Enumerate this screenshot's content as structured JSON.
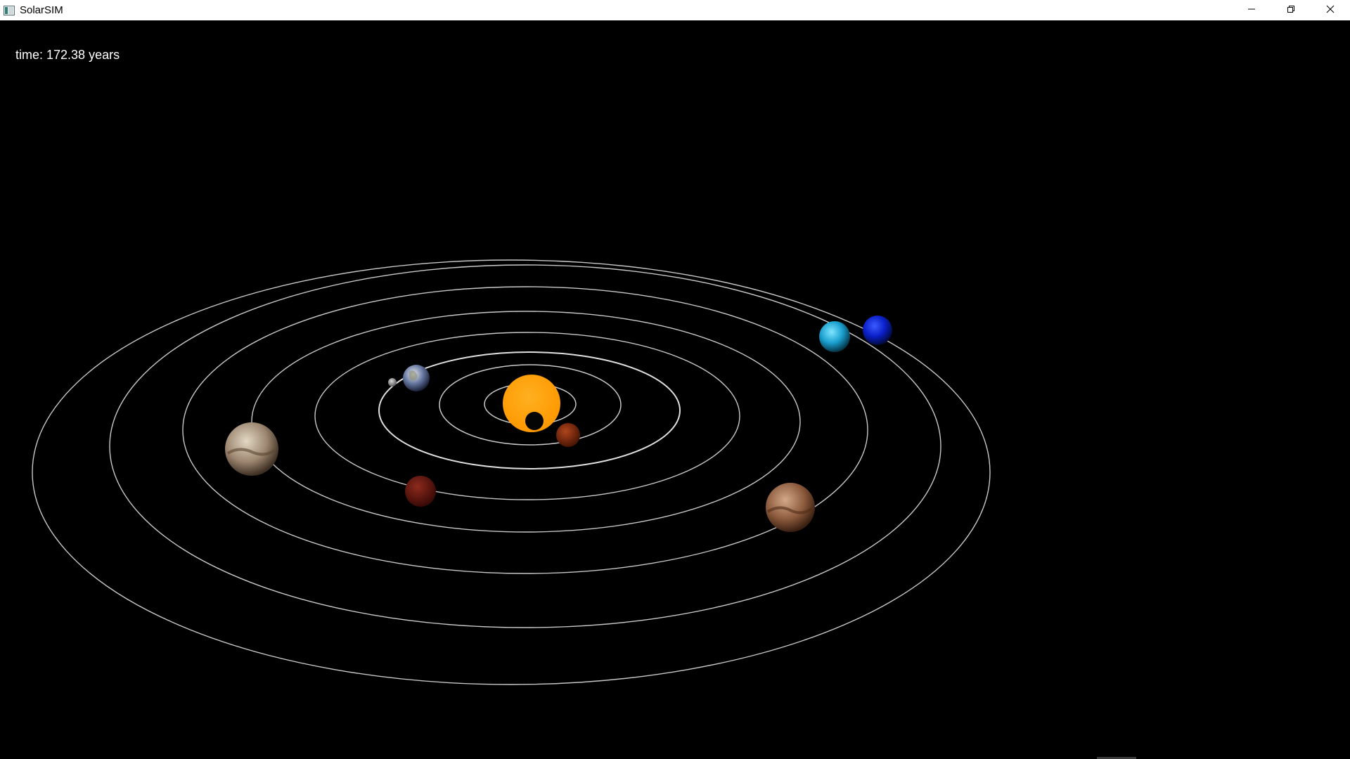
{
  "window": {
    "title": "SolarSIM",
    "icon": "app-window-icon",
    "controls": {
      "minimize_icon": "minimize-icon",
      "maximize_icon": "restore-icon",
      "close_icon": "close-icon"
    }
  },
  "hud": {
    "time_label": "time: 172.38 years"
  },
  "colors": {
    "background": "#000000",
    "orbit": "#c8c8c8",
    "sun": "#ff9f00",
    "sun_eclipse": "#050505"
  },
  "bodies": [
    {
      "name": "sun",
      "icon": "sun-icon"
    },
    {
      "name": "mercury",
      "icon": "planet-icon"
    },
    {
      "name": "venus",
      "icon": "planet-icon"
    },
    {
      "name": "earth",
      "icon": "earth-icon"
    },
    {
      "name": "moon",
      "icon": "moon-icon"
    },
    {
      "name": "mars",
      "icon": "planet-icon"
    },
    {
      "name": "jupiter",
      "icon": "planet-icon"
    },
    {
      "name": "saturn",
      "icon": "planet-icon"
    },
    {
      "name": "uranus",
      "icon": "planet-icon"
    },
    {
      "name": "neptune",
      "icon": "planet-icon"
    }
  ]
}
